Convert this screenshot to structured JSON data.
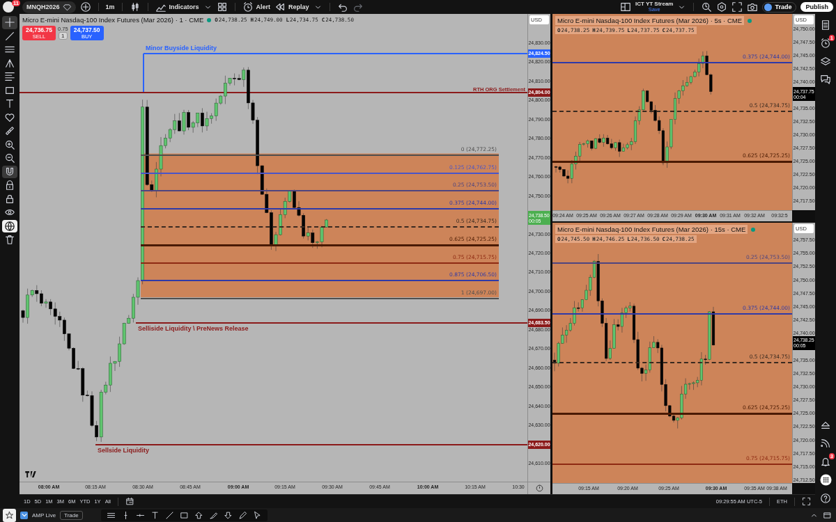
{
  "top_bar": {
    "notifications": "11",
    "symbol": "MNQH2026",
    "interval": "1m",
    "indicators": "Indicators",
    "alert": "Alert",
    "replay": "Replay",
    "layout_name": "ICT YT Stream",
    "layout_status": "Save",
    "trade": "Trade",
    "publish": "Publish"
  },
  "tools": [
    {
      "selected": true
    },
    {
      "selected": false
    },
    {
      "selected": false
    },
    {
      "selected": false
    },
    {
      "selected": false
    },
    {
      "selected": false
    },
    {
      "selected": false
    },
    {
      "selected": false
    },
    {
      "selected": false
    },
    {
      "selected": false
    },
    {
      "selected": false
    },
    {
      "selected": true
    },
    {
      "selected": false
    },
    {
      "selected": false
    },
    {
      "selected": false
    },
    {
      "selected": true
    },
    {
      "selected": false
    }
  ],
  "charts": [
    {
      "title": "Micro E-mini Nasdaq-100 Index Futures (Mar 2026) · 1 · CME",
      "ohlc": [
        {
          "label": "O",
          "value": "24,738.25"
        },
        {
          "label": "H",
          "value": "24,749.00"
        },
        {
          "label": "L",
          "value": "24,734.75"
        },
        {
          "label": "C",
          "value": "24,738.50"
        }
      ],
      "currency": "USD",
      "order_panel": {
        "sell_price": "24,736.75",
        "sell": "SELL",
        "spread": "0.75",
        "quantity": "1",
        "buy_price": "24,737.50",
        "buy": "BUY"
      },
      "price_axis": [
        "24,830.00",
        "24,820.00",
        "24,810.00",
        "24,800.00",
        "24,790.00",
        "24,780.00",
        "24,770.00",
        "24,760.00",
        "24,750.00",
        "24,730.00",
        "24,720.00",
        "24,710.00",
        "24,700.00",
        "24,690.00",
        "24,680.00",
        "24,670.00",
        "24,660.00",
        "24,650.00",
        "24,640.00",
        "24,630.00",
        "24,610.00"
      ],
      "time_axis": [
        {
          "label": "08:00 AM",
          "major": true
        },
        {
          "label": "08:15 AM",
          "major": false
        },
        {
          "label": "08:30 AM",
          "major": false
        },
        {
          "label": "08:45 AM",
          "major": false
        },
        {
          "label": "09:00 AM",
          "major": true
        },
        {
          "label": "09:15 AM",
          "major": false
        },
        {
          "label": "09:30 AM",
          "major": false
        },
        {
          "label": "09:45 AM",
          "major": false
        },
        {
          "label": "10:00 AM",
          "major": true
        },
        {
          "label": "10:15 AM",
          "major": false
        },
        {
          "label": "10:30",
          "major": false
        }
      ],
      "current_price": {
        "price": "24,738.50",
        "countdown": "00:05",
        "color": "#4caf50"
      },
      "fib_levels": [
        {
          "label": "0 (24,772.25)",
          "color": "#4f4f4f",
          "kind": "solid"
        },
        {
          "label": "0.125 (24,762.75)",
          "color": "#4a55c8",
          "kind": "solid"
        },
        {
          "label": "0.25 (24,753.50)",
          "color": "#4e4580",
          "kind": "solid"
        },
        {
          "label": "0.375 (24,744.00)",
          "color": "#2f3aa8",
          "kind": "solid"
        },
        {
          "label": "0.5 (24,734.75)",
          "color": "#3a2a20",
          "kind": "dashed"
        },
        {
          "label": "0.625 (24,725.25)",
          "color": "#4a1a02",
          "kind": "thick"
        },
        {
          "label": "0.75 (24,715.75)",
          "color": "#8e2a12",
          "kind": "solid"
        },
        {
          "label": "0.875 (24,706.50)",
          "color": "#2f3aa8",
          "kind": "solid"
        },
        {
          "label": "1 (24,697.00)",
          "color": "#4f4f4f",
          "kind": "solid"
        }
      ],
      "key_levels": [
        {
          "label": "Minor Buyside Liquidity",
          "tag": "24,824.50",
          "color": "#2962ff"
        },
        {
          "label": "RTH ORG Settlement",
          "tag": "24,804.00",
          "color": "#8b1a1a"
        },
        {
          "label": "Selliside Liquidity \\ PreNews Release",
          "tag": "24,683.50",
          "color": "#8b1a1a"
        },
        {
          "label": "Sellside Liquidity",
          "tag": "24,620.00",
          "color": "#8b1a1a"
        }
      ]
    },
    {
      "title": "Micro E-mini Nasdaq-100 Index Futures (Mar 2026) · 5s · CME",
      "ohlc": [
        {
          "label": "O",
          "value": "24,738.25"
        },
        {
          "label": "H",
          "value": "24,739.75"
        },
        {
          "label": "L",
          "value": "24,737.75"
        },
        {
          "label": "C",
          "value": "24,737.75"
        }
      ],
      "currency": "USD",
      "price_axis": [
        "24,750.00",
        "24,747.50",
        "24,745.00",
        "24,742.50",
        "24,740.00",
        "24,735.00",
        "24,732.50",
        "24,730.00",
        "24,727.50",
        "24,725.00",
        "24,722.50",
        "24,720.00",
        "24,717.50"
      ],
      "time_axis": [
        {
          "label": "09:24 AM",
          "major": false
        },
        {
          "label": "09:25 AM",
          "major": false
        },
        {
          "label": "09:26 AM",
          "major": false
        },
        {
          "label": "09:27 AM",
          "major": false
        },
        {
          "label": "09:28 AM",
          "major": false
        },
        {
          "label": "09:29 AM",
          "major": false
        },
        {
          "label": "09:30 AM",
          "major": true
        },
        {
          "label": "09:31 AM",
          "major": false
        },
        {
          "label": "09:32 AM",
          "major": false
        },
        {
          "label": "09:32:5",
          "major": false
        }
      ],
      "current_price": {
        "price": "24,737.75",
        "countdown": "00:04",
        "color": "#000000"
      },
      "fib_levels": [
        {
          "label": "0.375 (24,744.00)",
          "color": "#2f3aa8",
          "kind": "solid"
        },
        {
          "label": "0.5 (24,734.75)",
          "color": "#3a2a20",
          "kind": "dashed"
        },
        {
          "label": "0.625 (24,725.25)",
          "color": "#4a1a02",
          "kind": "thick"
        }
      ]
    },
    {
      "title": "Micro E-mini Nasdaq-100 Index Futures (Mar 2026) · 15s · CME",
      "ohlc": [
        {
          "label": "O",
          "value": "24,745.50"
        },
        {
          "label": "H",
          "value": "24,746.25"
        },
        {
          "label": "L",
          "value": "24,736.50"
        },
        {
          "label": "C",
          "value": "24,738.25"
        }
      ],
      "currency": "USD",
      "price_axis": [
        "24,757.50",
        "24,755.00",
        "24,752.50",
        "24,750.00",
        "24,747.50",
        "24,745.00",
        "24,742.50",
        "24,740.00",
        "24,735.00",
        "24,732.50",
        "24,730.00",
        "24,727.50",
        "24,725.00",
        "24,722.50",
        "24,720.00",
        "24,717.50",
        "24,715.00",
        "24,712.50"
      ],
      "time_axis": [
        {
          "label": "09:15 AM",
          "major": false
        },
        {
          "label": "09:20 AM",
          "major": false
        },
        {
          "label": "09:25 AM",
          "major": false
        },
        {
          "label": "09:30 AM",
          "major": true
        },
        {
          "label": "09:35 AM",
          "major": false
        },
        {
          "label": "09:38 AM",
          "major": false
        }
      ],
      "current_price": {
        "price": "24,738.25",
        "countdown": "00:05",
        "color": "#000000"
      },
      "fib_levels": [
        {
          "label": "0.25 (24,753.50)",
          "color": "#4e4580",
          "kind": "solid"
        },
        {
          "label": "0.375 (24,744.00)",
          "color": "#2f3aa8",
          "kind": "solid"
        },
        {
          "label": "0.5 (24,734.75)",
          "color": "#3a2a20",
          "kind": "dashed"
        },
        {
          "label": "0.625 (24,725.25)",
          "color": "#4a1a02",
          "kind": "thick"
        },
        {
          "label": "0.75 (24,715.75)",
          "color": "#8e2a12",
          "kind": "solid"
        }
      ]
    }
  ],
  "right_sidebar": {
    "alerts_badge": "1",
    "notifications_badge": "3"
  },
  "timeframe_bar": {
    "ranges": [
      "1D",
      "5D",
      "1M",
      "3M",
      "6M",
      "YTD",
      "1Y",
      "All"
    ],
    "clock": "09:29:55 AM UTC-5",
    "session": "ETH"
  },
  "bottom_bar": {
    "broker": "AMP Live",
    "trade": "Trade"
  }
}
